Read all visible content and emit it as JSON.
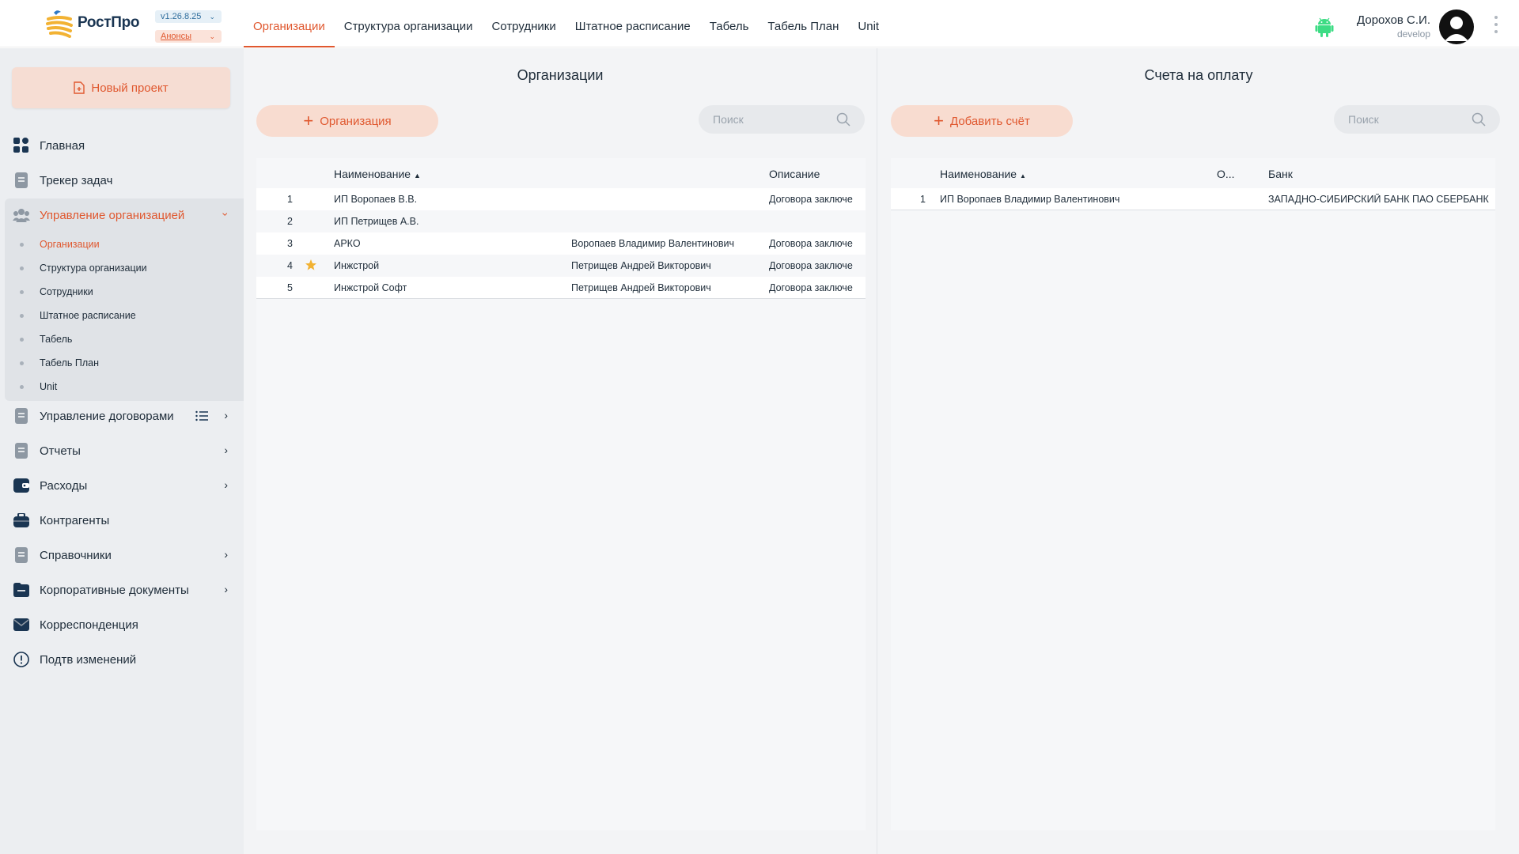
{
  "app": {
    "logo_text": "РостПро",
    "version": "v1.26.8.25",
    "announcements": "Анонсы"
  },
  "nav": [
    "Организации",
    "Структура организации",
    "Сотрудники",
    "Штатное расписание",
    "Табель",
    "Табель План",
    "Unit"
  ],
  "user": {
    "name": "Дорохов С.И.",
    "role": "develop"
  },
  "sidebar": {
    "new_project": "Новый проект",
    "items": [
      {
        "label": "Главная",
        "icon": "grid-icon"
      },
      {
        "label": "Трекер задач",
        "icon": "document-icon"
      },
      {
        "label": "Управление организацией",
        "icon": "users-icon"
      },
      {
        "label": "Управление договорами",
        "icon": "document-icon"
      },
      {
        "label": "Отчеты",
        "icon": "document-icon"
      },
      {
        "label": "Расходы",
        "icon": "wallet-icon"
      },
      {
        "label": "Контрагенты",
        "icon": "briefcase-icon"
      },
      {
        "label": "Справочники",
        "icon": "document-icon"
      },
      {
        "label": "Корпоративные документы",
        "icon": "folder-icon"
      },
      {
        "label": "Корреспонденция",
        "icon": "mail-icon"
      },
      {
        "label": "Подтв изменений",
        "icon": "alert-icon"
      }
    ],
    "sub_items": [
      "Организации",
      "Структура организации",
      "Сотрудники",
      "Штатное расписание",
      "Табель",
      "Табель План",
      "Unit"
    ]
  },
  "organizations": {
    "title": "Организации",
    "add_button": "Организация",
    "search_placeholder": "Поиск",
    "columns": [
      "Наименование",
      "Описание"
    ],
    "rows": [
      {
        "n": "1",
        "name": "ИП Воропаев В.В.",
        "person": "",
        "desc": "Договора заключе",
        "starred": false
      },
      {
        "n": "2",
        "name": "ИП Петрищев А.В.",
        "person": "",
        "desc": "",
        "starred": false
      },
      {
        "n": "3",
        "name": "АРКО",
        "person": "Воропаев Владимир Валентинович",
        "desc": "Договора заключе",
        "starred": false
      },
      {
        "n": "4",
        "name": "Инжстрой",
        "person": "Петрищев Андрей Викторович",
        "desc": "Договора заключе",
        "starred": true
      },
      {
        "n": "5",
        "name": "Инжстрой Софт",
        "person": "Петрищев Андрей Викторович",
        "desc": "Договора заключе",
        "starred": false
      }
    ]
  },
  "invoices": {
    "title": "Счета на оплату",
    "add_button": "Добавить счёт",
    "search_placeholder": "Поиск",
    "columns": [
      "Наименование",
      "О...",
      "Банк"
    ],
    "rows": [
      {
        "n": "1",
        "name": "ИП Воропаев Владимир Валентинович",
        "bank": "ЗАПАДНО-СИБИРСКИЙ БАНК ПАО СБЕРБАНК"
      }
    ]
  },
  "colors": {
    "accent": "#e0582f",
    "navy": "#1a3552",
    "sidebar_bg": "#eceef1"
  }
}
